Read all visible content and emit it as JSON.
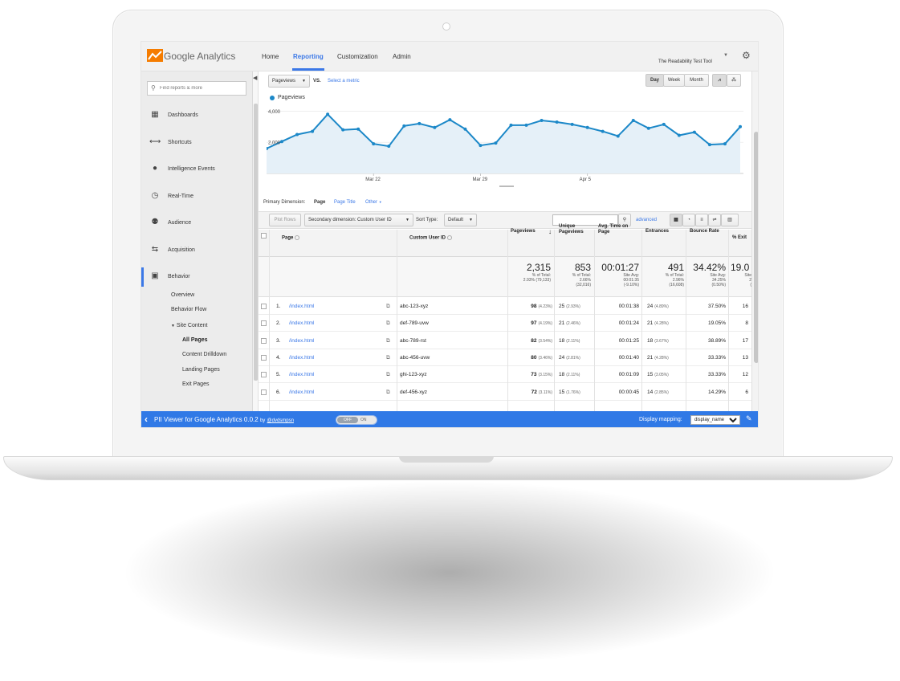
{
  "app": {
    "brand": "Google Analytics",
    "nav": [
      "Home",
      "Reporting",
      "Customization",
      "Admin"
    ],
    "active_nav": "Reporting",
    "account": "The Readability Test Tool",
    "accent": "#3b78e7"
  },
  "sidebar": {
    "search_placeholder": "Find reports & more",
    "items": [
      {
        "label": "Dashboards",
        "icon": "grid-icon"
      },
      {
        "label": "Shortcuts",
        "icon": "arrows-icon"
      },
      {
        "label": "Intelligence Events",
        "icon": "bulb-icon"
      },
      {
        "label": "Real-Time",
        "icon": "clock-icon"
      },
      {
        "label": "Audience",
        "icon": "people-icon"
      },
      {
        "label": "Acquisition",
        "icon": "acquisition-icon"
      },
      {
        "label": "Behavior",
        "icon": "behavior-icon"
      }
    ],
    "sub_items": {
      "overview": "Overview",
      "behavior_flow": "Behavior Flow",
      "site_content": "Site Content",
      "all_pages": "All Pages",
      "content_drilldown": "Content Drilldown",
      "landing_pages": "Landing Pages",
      "exit_pages": "Exit Pages"
    }
  },
  "controls": {
    "metric": "Pageviews",
    "vs": "VS.",
    "select_metric": "Select a metric",
    "day": "Day",
    "week": "Week",
    "month": "Month"
  },
  "chart_data": {
    "type": "area",
    "series": [
      {
        "name": "Pageviews",
        "values": [
          1600,
          2050,
          2500,
          2700,
          3800,
          2800,
          2850,
          1900,
          1750,
          3050,
          3200,
          2950,
          3450,
          2850,
          1800,
          1950,
          3100,
          3100,
          3400,
          3300,
          3150,
          2950,
          2700,
          2400,
          3400,
          2900,
          3150,
          2450,
          2650,
          1850,
          1900,
          3000
        ]
      }
    ],
    "x_tick_labels": [
      "Mar 22",
      "Mar 29",
      "Apr 5"
    ],
    "y_tick_labels": [
      "4,000",
      "2,000"
    ],
    "ylim": [
      0,
      5000
    ],
    "grid": true,
    "line_color": "#1c88c8",
    "fill_color": "#e5f0f8"
  },
  "dimension": {
    "primary_label": "Primary Dimension:",
    "page": "Page",
    "page_title": "Page Title",
    "other": "Other"
  },
  "table_tools": {
    "plot_rows": "Plot Rows",
    "secondary": "Secondary dimension: Custom User ID",
    "sort_type": "Sort Type:",
    "sort_default": "Default",
    "advanced": "advanced"
  },
  "table": {
    "columns": [
      "Page",
      "Custom User ID",
      "Pageviews",
      "Unique Pageviews",
      "Avg. Time on Page",
      "Entrances",
      "Bounce Rate",
      "% Exit"
    ],
    "totals": {
      "pageviews": {
        "value": "2,315",
        "sub1": "% of Total:",
        "sub2": "2.93% (79,133)"
      },
      "unique": {
        "value": "853",
        "sub1": "% of Total:",
        "sub2": "2.66%",
        "sub3": "(32,016)"
      },
      "avg_time": {
        "value": "00:01:27",
        "sub1": "Site Avg:",
        "sub2": "00:01:35",
        "sub3": "(-9.10%)"
      },
      "entrances": {
        "value": "491",
        "sub1": "% of Total:",
        "sub2": "2.96%",
        "sub3": "(16,608)"
      },
      "bounce": {
        "value": "34.42%",
        "sub1": "Site Avg:",
        "sub2": "34.25%",
        "sub3": "(0.50%)"
      },
      "exit": {
        "value": "19.0",
        "sub1": "Site",
        "sub2": "2",
        "sub3": "("
      }
    },
    "rows": [
      {
        "num": "1.",
        "page": "/index.html",
        "user": "abc-123-xyz",
        "pv": "98",
        "pv_pct": "(4.23%)",
        "upv": "25",
        "upv_pct": "(2.93%)",
        "time": "00:01:38",
        "ent": "24",
        "ent_pct": "(4.89%)",
        "bounce": "37.50%",
        "exit": "16"
      },
      {
        "num": "2.",
        "page": "/index.html",
        "user": "def-789-uvw",
        "pv": "97",
        "pv_pct": "(4.19%)",
        "upv": "21",
        "upv_pct": "(2.46%)",
        "time": "00:01:24",
        "ent": "21",
        "ent_pct": "(4.28%)",
        "bounce": "19.05%",
        "exit": "8"
      },
      {
        "num": "3.",
        "page": "/index.html",
        "user": "abc-789-rst",
        "pv": "82",
        "pv_pct": "(3.54%)",
        "upv": "18",
        "upv_pct": "(2.11%)",
        "time": "00:01:25",
        "ent": "18",
        "ent_pct": "(3.67%)",
        "bounce": "38.89%",
        "exit": "17"
      },
      {
        "num": "4.",
        "page": "/index.html",
        "user": "abc-456-uvw",
        "pv": "80",
        "pv_pct": "(3.46%)",
        "upv": "24",
        "upv_pct": "(2.81%)",
        "time": "00:01:40",
        "ent": "21",
        "ent_pct": "(4.28%)",
        "bounce": "33.33%",
        "exit": "13"
      },
      {
        "num": "5.",
        "page": "/index.html",
        "user": "ghi-123-xyz",
        "pv": "73",
        "pv_pct": "(3.15%)",
        "upv": "18",
        "upv_pct": "(2.11%)",
        "time": "00:01:09",
        "ent": "15",
        "ent_pct": "(3.05%)",
        "bounce": "33.33%",
        "exit": "12"
      },
      {
        "num": "6.",
        "page": "/index.html",
        "user": "def-456-xyz",
        "pv": "72",
        "pv_pct": "(3.11%)",
        "upv": "15",
        "upv_pct": "(1.76%)",
        "time": "00:00:45",
        "ent": "14",
        "ent_pct": "(2.85%)",
        "bounce": "14.29%",
        "exit": "6"
      }
    ]
  },
  "pii_bar": {
    "title": "PII Viewer for Google Analytics 0.0.2",
    "by": "by",
    "author": "@dvdsmpsn",
    "toggle_off": "OFF",
    "toggle_on": "ON",
    "mapping_label": "Display mapping:",
    "mapping_value": "display_name",
    "color": "#3079e6"
  }
}
